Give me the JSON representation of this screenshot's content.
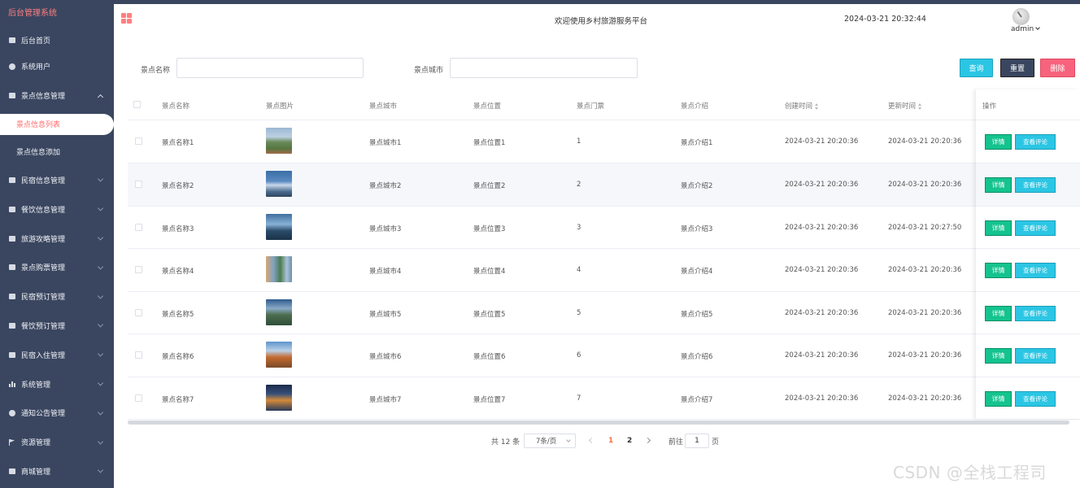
{
  "sidebar": {
    "brand": "后台管理系统",
    "items": [
      {
        "label": "后台首页",
        "icon": "home-icon"
      },
      {
        "label": "系统用户",
        "icon": "user-icon"
      },
      {
        "label": "景点信息管理",
        "icon": "menu-icon",
        "expanded": true
      },
      {
        "label": "民宿信息管理",
        "icon": "menu-icon"
      },
      {
        "label": "餐饮信息管理",
        "icon": "menu-icon"
      },
      {
        "label": "旅游攻略管理",
        "icon": "menu-icon"
      },
      {
        "label": "景点购票管理",
        "icon": "menu-icon"
      },
      {
        "label": "民宿预订管理",
        "icon": "menu-icon"
      },
      {
        "label": "餐饮预订管理",
        "icon": "menu-icon"
      },
      {
        "label": "民宿入住管理",
        "icon": "menu-icon"
      },
      {
        "label": "系统管理",
        "icon": "chart-icon"
      },
      {
        "label": "通知公告管理",
        "icon": "info-icon"
      },
      {
        "label": "资源管理",
        "icon": "flag-icon"
      },
      {
        "label": "商城管理",
        "icon": "shop-icon"
      }
    ],
    "submenu": [
      "景点信息列表",
      "景点信息添加"
    ]
  },
  "header": {
    "welcome": "欢迎使用乡村旅游服务平台",
    "datetime": "2024-03-21 20:32:44",
    "username": "admin",
    "accent": "#ff7f7f"
  },
  "search": {
    "name_label": "景点名称",
    "city_label": "景点城市",
    "name_value": "",
    "city_value": "",
    "query_btn": "查询",
    "reset_btn": "重置",
    "delete_btn": "删除"
  },
  "table": {
    "columns": [
      "景点名称",
      "景点图片",
      "景点城市",
      "景点位置",
      "景点门票",
      "景点介绍",
      "创建时间",
      "更新时间",
      "操作"
    ],
    "rows": [
      {
        "name": "景点名称1",
        "city": "景点城市1",
        "location": "景点位置1",
        "ticket": "1",
        "intro": "景点介绍1",
        "created": "2024-03-21 20:20:36",
        "updated": "2024-03-21 20:20:36"
      },
      {
        "name": "景点名称2",
        "city": "景点城市2",
        "location": "景点位置2",
        "ticket": "2",
        "intro": "景点介绍2",
        "created": "2024-03-21 20:20:36",
        "updated": "2024-03-21 20:20:36"
      },
      {
        "name": "景点名称3",
        "city": "景点城市3",
        "location": "景点位置3",
        "ticket": "3",
        "intro": "景点介绍3",
        "created": "2024-03-21 20:20:36",
        "updated": "2024-03-21 20:27:50"
      },
      {
        "name": "景点名称4",
        "city": "景点城市4",
        "location": "景点位置4",
        "ticket": "4",
        "intro": "景点介绍4",
        "created": "2024-03-21 20:20:36",
        "updated": "2024-03-21 20:20:36"
      },
      {
        "name": "景点名称5",
        "city": "景点城市5",
        "location": "景点位置5",
        "ticket": "5",
        "intro": "景点介绍5",
        "created": "2024-03-21 20:20:36",
        "updated": "2024-03-21 20:20:36"
      },
      {
        "name": "景点名称6",
        "city": "景点城市6",
        "location": "景点位置6",
        "ticket": "6",
        "intro": "景点介绍6",
        "created": "2024-03-21 20:20:36",
        "updated": "2024-03-21 20:20:36"
      },
      {
        "name": "景点名称7",
        "city": "景点城市7",
        "location": "景点位置7",
        "ticket": "7",
        "intro": "景点介绍7",
        "created": "2024-03-21 20:20:36",
        "updated": "2024-03-21 20:20:36"
      }
    ],
    "detail_btn": "详情",
    "review_btn": "查看评论"
  },
  "pagination": {
    "total": "共 12 条",
    "page_size": "7条/页",
    "pages": [
      "1",
      "2"
    ],
    "current": "1",
    "goto_label": "前往",
    "goto_value": "1",
    "page_suffix": "页"
  },
  "watermark": "CSDN @全栈工程司"
}
